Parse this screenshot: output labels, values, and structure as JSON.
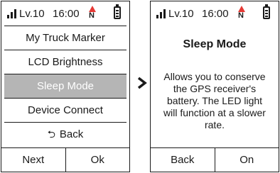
{
  "left_screen": {
    "status": {
      "level": "Lv.10",
      "time": "16:00",
      "compass_letter": "N"
    },
    "menu": [
      {
        "label": "My Truck Marker",
        "selected": false
      },
      {
        "label": "LCD Brightness",
        "selected": false
      },
      {
        "label": "Sleep Mode",
        "selected": true
      },
      {
        "label": "Device Connect",
        "selected": false
      },
      {
        "label": "Back",
        "icon": "back-arrow-icon",
        "selected": false
      }
    ],
    "buttons": {
      "left": "Next",
      "right": "Ok"
    }
  },
  "right_screen": {
    "status": {
      "level": "Lv.10",
      "time": "16:00",
      "compass_letter": "N"
    },
    "title": "Sleep Mode",
    "description": "Allows you to conserve the GPS receiver's battery. The LED light will function at a slower rate.",
    "buttons": {
      "left": "Back",
      "right": "On"
    }
  },
  "colors": {
    "selected_bg": "#b5b5b5",
    "compass_red": "#e53935",
    "border": "#1a1a1a"
  }
}
